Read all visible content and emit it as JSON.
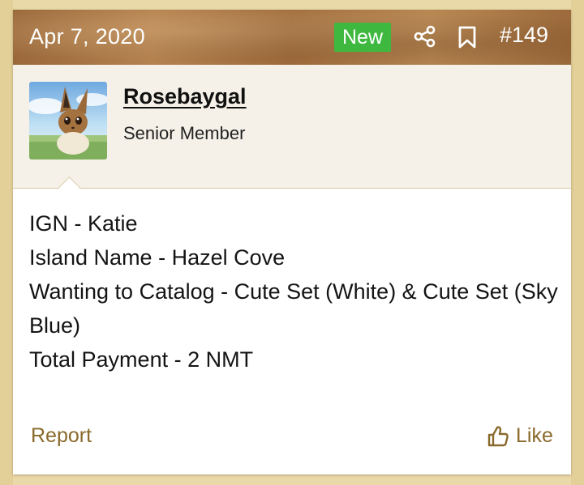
{
  "post": {
    "date": "Apr 7, 2020",
    "badge": "New",
    "number": "#149"
  },
  "user": {
    "name": "Rosebaygal",
    "title": "Senior Member",
    "avatar_icon": "eevee-avatar"
  },
  "content": {
    "lines": [
      "IGN - Katie",
      "Island Name - Hazel Cove",
      "Wanting to Catalog - Cute Set (White) & Cute Set (Sky Blue)",
      "Total Payment - 2 NMT"
    ]
  },
  "actions": {
    "report": "Report",
    "like": "Like"
  },
  "colors": {
    "badge": "#3fb83f",
    "action_text": "#8a6a2c",
    "user_bar": "#f5f1e8",
    "page_bg": "#ead9a8"
  }
}
